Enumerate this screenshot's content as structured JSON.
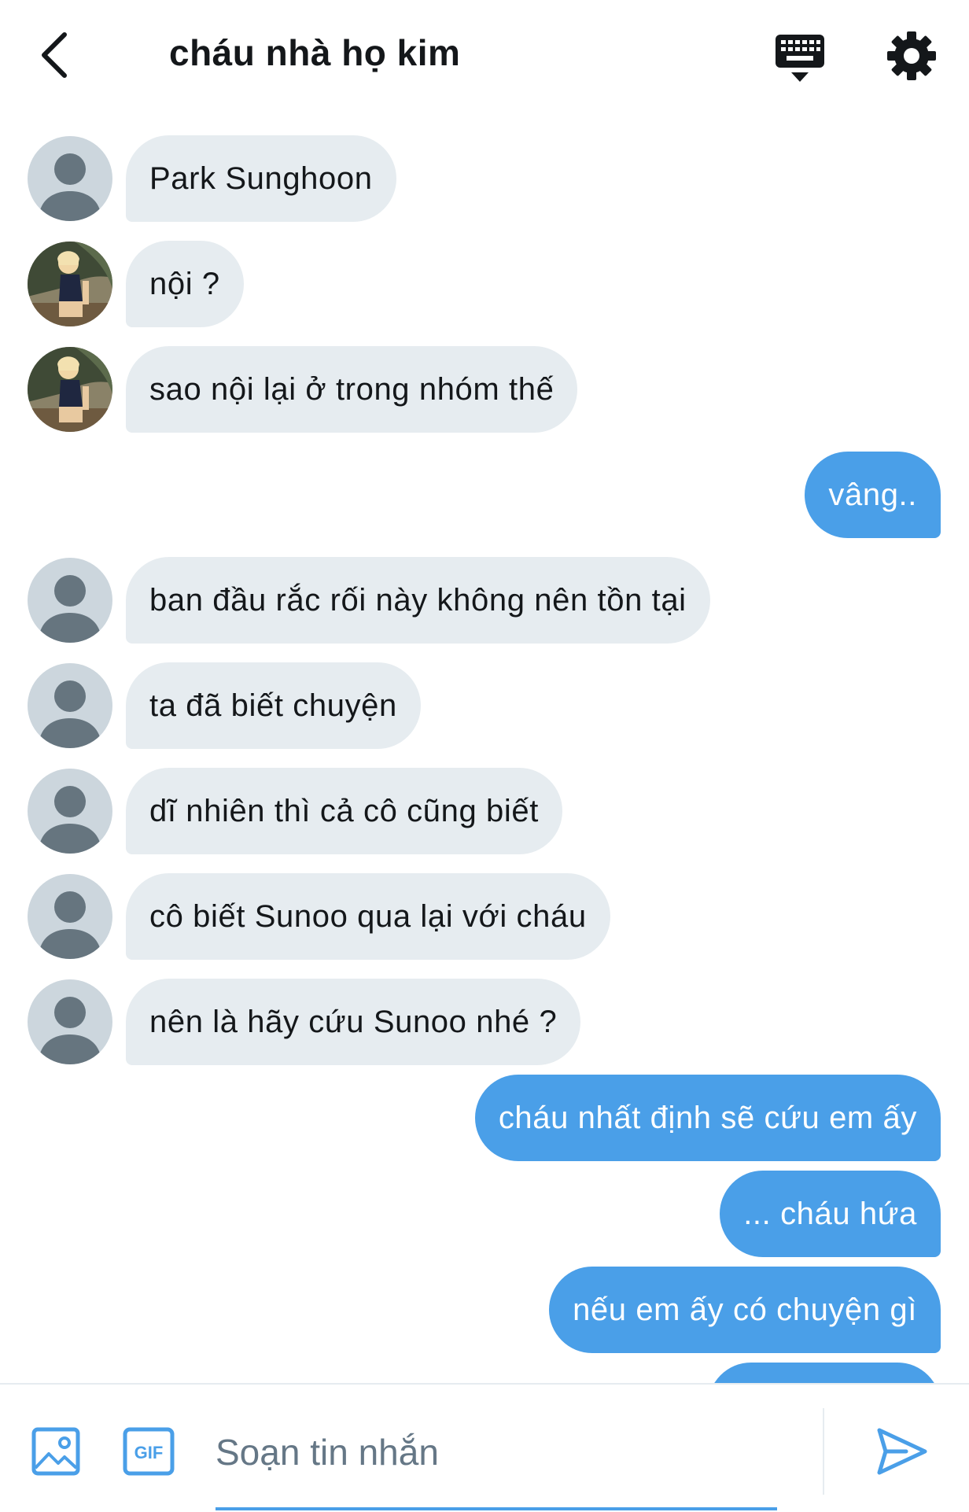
{
  "header": {
    "title": "cháu nhà họ kim",
    "back_icon": "chevron-left-icon",
    "keyboard_icon": "keyboard-icon",
    "settings_icon": "gear-icon"
  },
  "messages": [
    {
      "direction": "in",
      "avatar": "default",
      "text": "Park Sunghoon"
    },
    {
      "direction": "in",
      "avatar": "photo",
      "text": "nội ?"
    },
    {
      "direction": "in",
      "avatar": "photo",
      "text": "sao nội lại ở trong nhóm thế"
    },
    {
      "direction": "out",
      "text": "vâng.."
    },
    {
      "direction": "in",
      "avatar": "default",
      "text": "ban đầu rắc rối này không nên tồn tại"
    },
    {
      "direction": "in",
      "avatar": "default",
      "text": "ta đã biết chuyện"
    },
    {
      "direction": "in",
      "avatar": "default",
      "text": "dĩ nhiên thì cả cô cũng biết"
    },
    {
      "direction": "in",
      "avatar": "default",
      "text": "cô biết Sunoo qua lại với cháu"
    },
    {
      "direction": "in",
      "avatar": "default",
      "text": "nên là hãy cứu Sunoo nhé ?"
    },
    {
      "direction": "out",
      "text": "cháu nhất định sẽ cứu em ấy"
    },
    {
      "direction": "out",
      "text": "... cháu hứa"
    },
    {
      "direction": "out",
      "text": "nếu em ấy có chuyện gì"
    },
    {
      "direction": "out",
      "text": ""
    }
  ],
  "composer": {
    "placeholder": "Soạn tin nhắn",
    "value": "",
    "image_icon": "image-icon",
    "gif_icon": "gif-icon",
    "gif_label": "GIF",
    "send_icon": "send-icon"
  },
  "colors": {
    "outgoing_bubble": "#4a9fe8",
    "incoming_bubble": "#e6ecf0",
    "text": "#14171a",
    "accent": "#4a9fe8"
  }
}
